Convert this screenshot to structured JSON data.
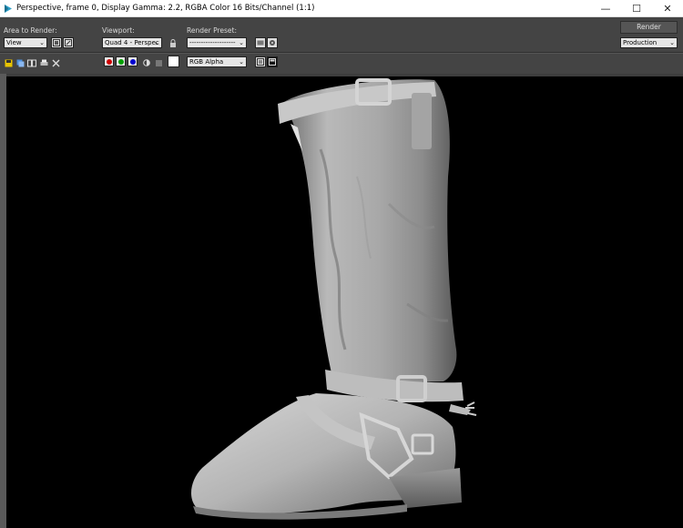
{
  "window": {
    "title": "Perspective, frame 0, Display Gamma: 2.2, RGBA Color 16 Bits/Channel (1:1)",
    "minimize": "—",
    "maximize": "☐",
    "close": "✕"
  },
  "toolbar": {
    "area_label": "Area to Render:",
    "area_value": "View",
    "viewport_label": "Viewport:",
    "viewport_value": "Quad 4 - Perspec",
    "preset_label": "Render Preset:",
    "preset_value": "--------------------",
    "render_button": "Render",
    "mode_value": "Production",
    "channel_value": "RGB Alpha"
  },
  "colors": {
    "red_channel": "#d00000",
    "green_channel": "#00a000",
    "blue_channel": "#0000d0",
    "accent": "#2b9fc9"
  },
  "icons": [
    "app-icon",
    "edit-region-icon",
    "auto-region-icon",
    "lock-icon",
    "preset-load-icon",
    "preset-save-icon",
    "save-image-icon",
    "copy-image-icon",
    "clone-window-icon",
    "print-icon",
    "clear-icon",
    "mono-icon",
    "alpha-icon",
    "display-toggle-icon",
    "frame-toggle-icon"
  ]
}
